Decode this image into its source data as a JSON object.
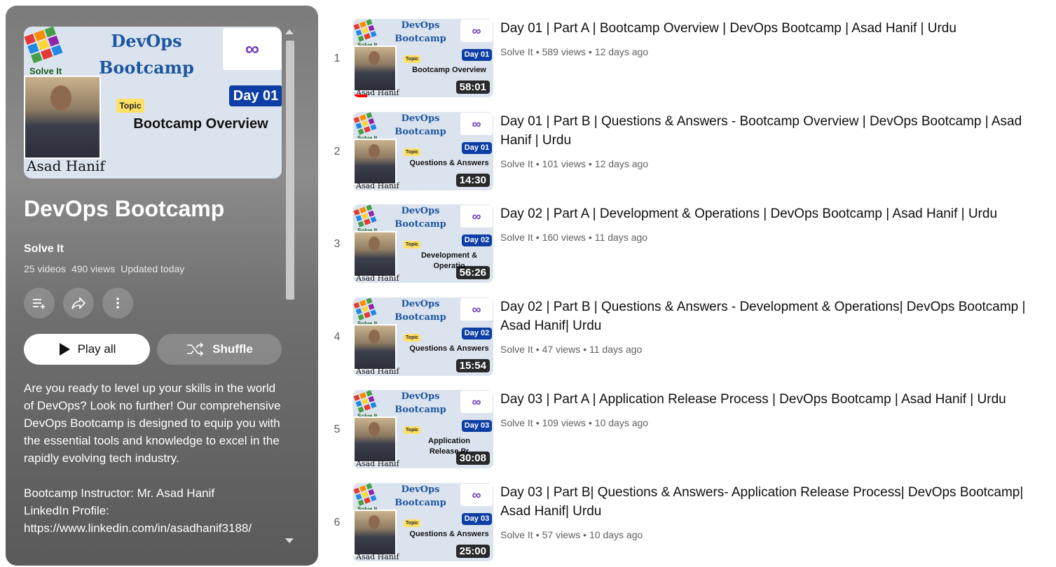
{
  "playlist": {
    "cover": {
      "brand": "Solve It",
      "title_line1": "DevOps",
      "title_line2": "Bootcamp",
      "day_badge": "Day 01",
      "topic_tag": "Topic",
      "topic": "Bootcamp Overview",
      "person_name": "Asad Hanif"
    },
    "title": "DevOps Bootcamp",
    "channel": "Solve It",
    "video_count": "25 videos",
    "views": "490 views",
    "updated": "Updated today",
    "actions": {
      "save_icon": "playlist-add-icon",
      "share_icon": "share-icon",
      "more_icon": "more-vert-icon"
    },
    "play_all_label": "Play all",
    "shuffle_label": "Shuffle",
    "description": "Are you ready to level up your skills in the world of DevOps? Look no further! Our comprehensive DevOps Bootcamp is designed to equip you with the essential tools and knowledge to excel in the rapidly evolving tech industry.\n\nBootcamp Instructor: Mr. Asad Hanif\nLinkedIn Profile:\nhttps://www.linkedin.com/in/asadhanif3188/"
  },
  "videos": [
    {
      "index": "1",
      "title": "Day 01 | Part A | Bootcamp Overview | DevOps Bootcamp | Asad Hanif | Urdu",
      "channel": "Solve It",
      "views": "589 views",
      "age": "12 days ago",
      "duration": "58:01",
      "watch_progress": 0.1,
      "thumb": {
        "day": "Day 01",
        "topic": "Topic",
        "line1": "Bootcamp Overview",
        "line2": "",
        "name": "Asad Hanif",
        "brand": "Solve It",
        "title1": "DevOps",
        "title2": "Bootcamp"
      }
    },
    {
      "index": "2",
      "title": "Day 01 | Part B | Questions & Answers - Bootcamp Overview | DevOps Bootcamp | Asad Hanif | Urdu",
      "channel": "Solve It",
      "views": "101 views",
      "age": "12 days ago",
      "duration": "14:30",
      "watch_progress": 0,
      "thumb": {
        "day": "Day 01",
        "topic": "Topic",
        "line1": "Questions & Answers",
        "line2": "",
        "name": "Asad Hanif",
        "brand": "Solve It",
        "title1": "DevOps",
        "title2": "Bootcamp"
      }
    },
    {
      "index": "3",
      "title": "Day 02 | Part A | Development & Operations | DevOps Bootcamp | Asad Hanif | Urdu",
      "channel": "Solve It",
      "views": "160 views",
      "age": "11 days ago",
      "duration": "56:26",
      "watch_progress": 0,
      "thumb": {
        "day": "Day 02",
        "topic": "Topic",
        "line1": "Development &",
        "line2": "Operatio",
        "name": "Asad Hanif",
        "brand": "Solve It",
        "title1": "DevOps",
        "title2": "Bootcamp"
      }
    },
    {
      "index": "4",
      "title": "Day 02 | Part B | Questions & Answers - Development & Operations| DevOps Bootcamp | Asad Hanif| Urdu",
      "channel": "Solve It",
      "views": "47 views",
      "age": "11 days ago",
      "duration": "15:54",
      "watch_progress": 0,
      "thumb": {
        "day": "Day 02",
        "topic": "Topic",
        "line1": "Questions & Answers",
        "line2": "",
        "name": "Asad Hanif",
        "brand": "Solve It",
        "title1": "DevOps",
        "title2": "Bootcamp"
      }
    },
    {
      "index": "5",
      "title": "Day 03 | Part A | Application Release Process | DevOps Bootcamp | Asad Hanif | Urdu",
      "channel": "Solve It",
      "views": "109 views",
      "age": "10 days ago",
      "duration": "30:08",
      "watch_progress": 0,
      "thumb": {
        "day": "Day 03",
        "topic": "Topic",
        "line1": "Application",
        "line2": "Release Pr",
        "name": "Asad Hanif",
        "brand": "Solve It",
        "title1": "DevOps",
        "title2": "Bootcamp"
      }
    },
    {
      "index": "6",
      "title": "Day 03 | Part B| Questions & Answers- Application Release Process| DevOps Bootcamp| Asad Hanif| Urdu",
      "channel": "Solve It",
      "views": "57 views",
      "age": "10 days ago",
      "duration": "25:00",
      "watch_progress": 0,
      "thumb": {
        "day": "Day 03",
        "topic": "Topic",
        "line1": "Questions & Answers",
        "line2": "",
        "name": "Asad Hanif",
        "brand": "Solve It",
        "title1": "DevOps",
        "title2": "Bootcamp"
      }
    }
  ],
  "colors": {
    "accent_red": "#ff0000",
    "day_badge": "#0d3ea5",
    "topic_tag": "#ffe066",
    "title_blue": "#1e56a0"
  }
}
